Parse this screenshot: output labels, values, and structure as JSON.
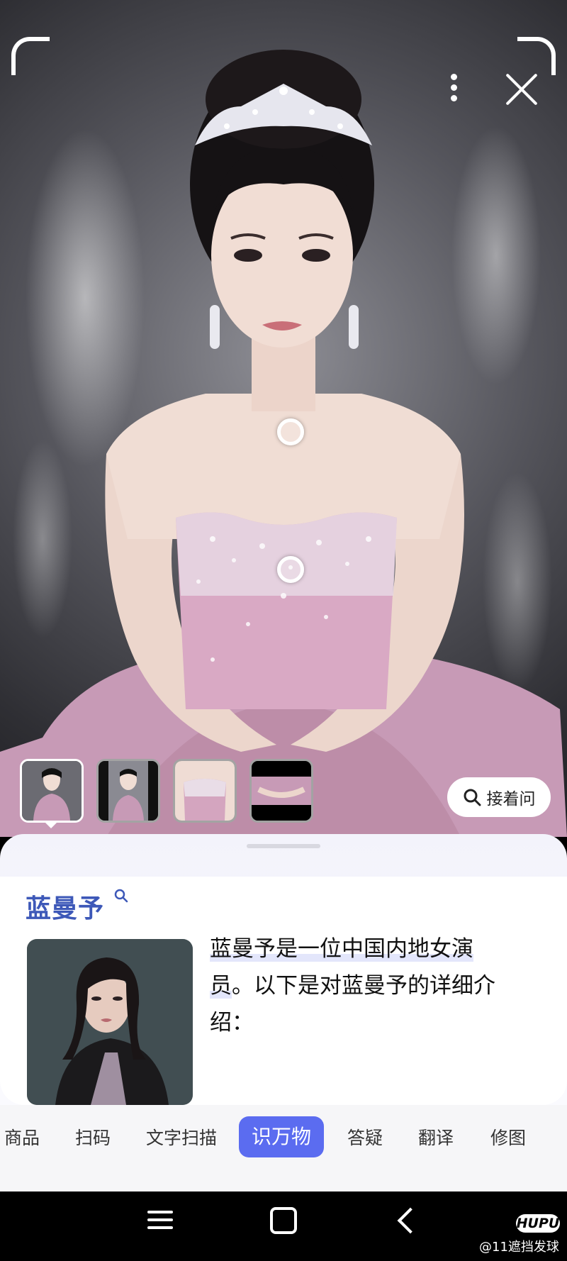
{
  "viewer": {
    "more_icon": "more-vertical-icon",
    "close_icon": "close-icon"
  },
  "thumbnails": [
    {
      "label": "full-portrait",
      "active": true
    },
    {
      "label": "portrait-crop",
      "active": false
    },
    {
      "label": "dress-crop",
      "active": false
    },
    {
      "label": "hands-crop",
      "active": false
    }
  ],
  "ask_button": {
    "icon": "search-icon",
    "label": "接着问"
  },
  "result": {
    "title": "蓝曼予",
    "title_icon": "search-icon",
    "description_line1": "蓝曼予是一位中国内地女演",
    "description_line2a": "员",
    "description_line2b": "。以下是对蓝曼予的详细介",
    "description_line3": "绍："
  },
  "modes": [
    {
      "label": "商品",
      "active": false
    },
    {
      "label": "扫码",
      "active": false
    },
    {
      "label": "文字扫描",
      "active": false
    },
    {
      "label": "识万物",
      "active": true
    },
    {
      "label": "答疑",
      "active": false
    },
    {
      "label": "翻译",
      "active": false
    },
    {
      "label": "修图",
      "active": false
    }
  ],
  "navbar": {
    "menu_icon": "menu-icon",
    "home_icon": "home-icon",
    "back_icon": "back-icon"
  },
  "watermark": {
    "logo": "HUPU",
    "text": "@11遮挡发球"
  },
  "colors": {
    "accent": "#5b6cf0",
    "title": "#3d58b8",
    "dress": "#c79ab6"
  }
}
